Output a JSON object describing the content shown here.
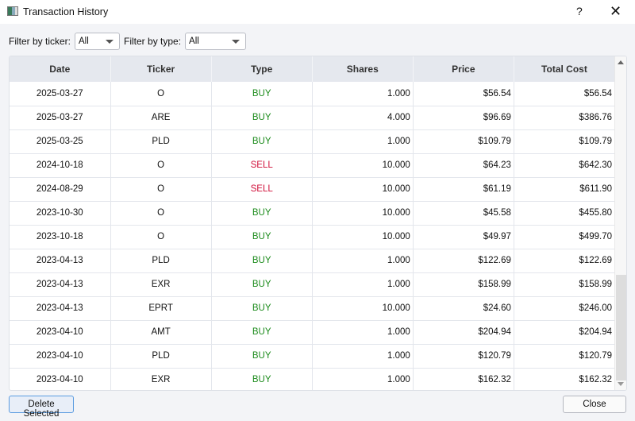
{
  "window": {
    "title": "Transaction History",
    "help": "?",
    "close": "✕"
  },
  "filters": {
    "ticker_label": "Filter by ticker:",
    "ticker_value": "All",
    "type_label": "Filter by type:",
    "type_value": "All"
  },
  "columns": [
    "Date",
    "Ticker",
    "Type",
    "Shares",
    "Price",
    "Total Cost"
  ],
  "rows": [
    [
      "2025-03-27",
      "O",
      "BUY",
      "1.000",
      "$56.54",
      "$56.54"
    ],
    [
      "2025-03-27",
      "ARE",
      "BUY",
      "4.000",
      "$96.69",
      "$386.76"
    ],
    [
      "2025-03-25",
      "PLD",
      "BUY",
      "1.000",
      "$109.79",
      "$109.79"
    ],
    [
      "2024-10-18",
      "O",
      "SELL",
      "10.000",
      "$64.23",
      "$642.30"
    ],
    [
      "2024-08-29",
      "O",
      "SELL",
      "10.000",
      "$61.19",
      "$611.90"
    ],
    [
      "2023-10-30",
      "O",
      "BUY",
      "10.000",
      "$45.58",
      "$455.80"
    ],
    [
      "2023-10-18",
      "O",
      "BUY",
      "10.000",
      "$49.97",
      "$499.70"
    ],
    [
      "2023-04-13",
      "PLD",
      "BUY",
      "1.000",
      "$122.69",
      "$122.69"
    ],
    [
      "2023-04-13",
      "EXR",
      "BUY",
      "1.000",
      "$158.99",
      "$158.99"
    ],
    [
      "2023-04-13",
      "EPRT",
      "BUY",
      "10.000",
      "$24.60",
      "$246.00"
    ],
    [
      "2023-04-10",
      "AMT",
      "BUY",
      "1.000",
      "$204.94",
      "$204.94"
    ],
    [
      "2023-04-10",
      "PLD",
      "BUY",
      "1.000",
      "$120.79",
      "$120.79"
    ],
    [
      "2023-04-10",
      "EXR",
      "BUY",
      "1.000",
      "$162.32",
      "$162.32"
    ]
  ],
  "buttons": {
    "delete": "Delete Selected",
    "close": "Close"
  },
  "colors": {
    "buy": "#1a8a1a",
    "sell": "#d0103a"
  }
}
